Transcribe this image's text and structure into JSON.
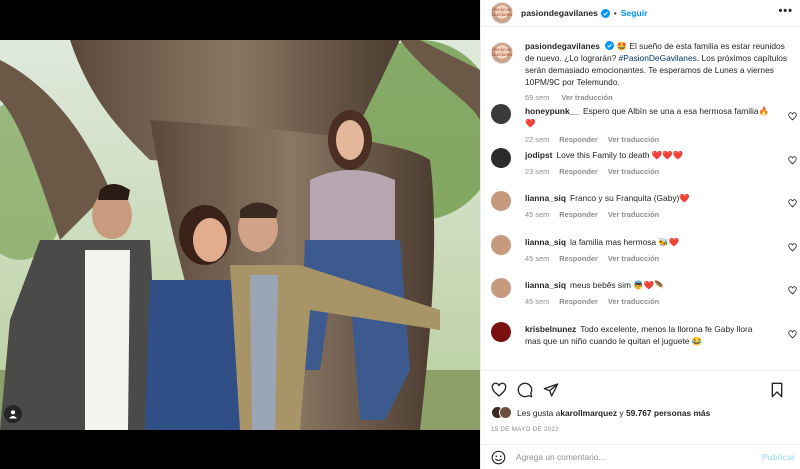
{
  "post": {
    "username": "pasiondegavilanes",
    "avatar_text": "Pasión de Gavilanes",
    "follow_label": "Seguir",
    "more_label": "•••",
    "dot": "•"
  },
  "caption": {
    "username": "pasiondegavilanes",
    "emoji": "🤩",
    "text": " El sueño de esta familia es estar reunidos de nuevo. ¿Lo lograrán? ",
    "hashtag": "#PasionDeGavilanes",
    "text2": ". Los próximos capítulos serán demasiado emocionantes. Te esperamos de Lunes a viernes 10PM/9C por Telemundo.",
    "time": "69 sem",
    "translate": "Ver traducción"
  },
  "comments": [
    {
      "user": "honeypunk__",
      "text": "Espero que Albín se una a esa hermosa familia🔥❤️",
      "time": "22 sem",
      "reply": "Responder",
      "translate": "Ver traducción",
      "avatar_color": "#3a3a3a"
    },
    {
      "user": "jodipst",
      "text": "Love this Family to death ❤️❤️❤️",
      "time": "23 sem",
      "reply": "Responder",
      "translate": "Ver traducción",
      "avatar_color": "#2b2b2b"
    },
    {
      "user": "lianna_siq",
      "text": "Franco y su Franquita (Gaby)❤️",
      "time": "45 sem",
      "reply": "Responder",
      "translate": "Ver traducción",
      "avatar_color": "#c69a7d"
    },
    {
      "user": "lianna_siq",
      "text": "la familia mas hermosa 🐝❤️",
      "time": "45 sem",
      "reply": "Responder",
      "translate": "Ver traducción",
      "avatar_color": "#c69a7d"
    },
    {
      "user": "lianna_siq",
      "text": "meus bebês sim 👼❤️🪶",
      "time": "45 sem",
      "reply": "Responder",
      "translate": "Ver traducción",
      "avatar_color": "#c69a7d"
    },
    {
      "user": "krisbelnunez",
      "text": "Todo excelente, menos la llorona fe Gaby llora mas que un niño cuando le quitan el juguete 😂",
      "time": "",
      "reply": "",
      "translate": "",
      "avatar_color": "#7a1010"
    }
  ],
  "likes": {
    "prefix": "Les gusta a ",
    "user": "karollmarquez",
    "mid": " y ",
    "count": "59.767 personas más"
  },
  "date": "15 DE MAYO DE 2022",
  "add_comment": {
    "placeholder": "Agrega un comentario...",
    "publish": "Publicar"
  },
  "colors": {
    "link": "#0095f6",
    "hashtag": "#00376b",
    "heart_red": "#ed4956",
    "muted": "#8e8e8e"
  },
  "icons": [
    "heart-icon",
    "comment-icon",
    "share-icon",
    "save-icon",
    "emoji-icon",
    "verified-icon",
    "user-tag-icon",
    "more-icon"
  ]
}
